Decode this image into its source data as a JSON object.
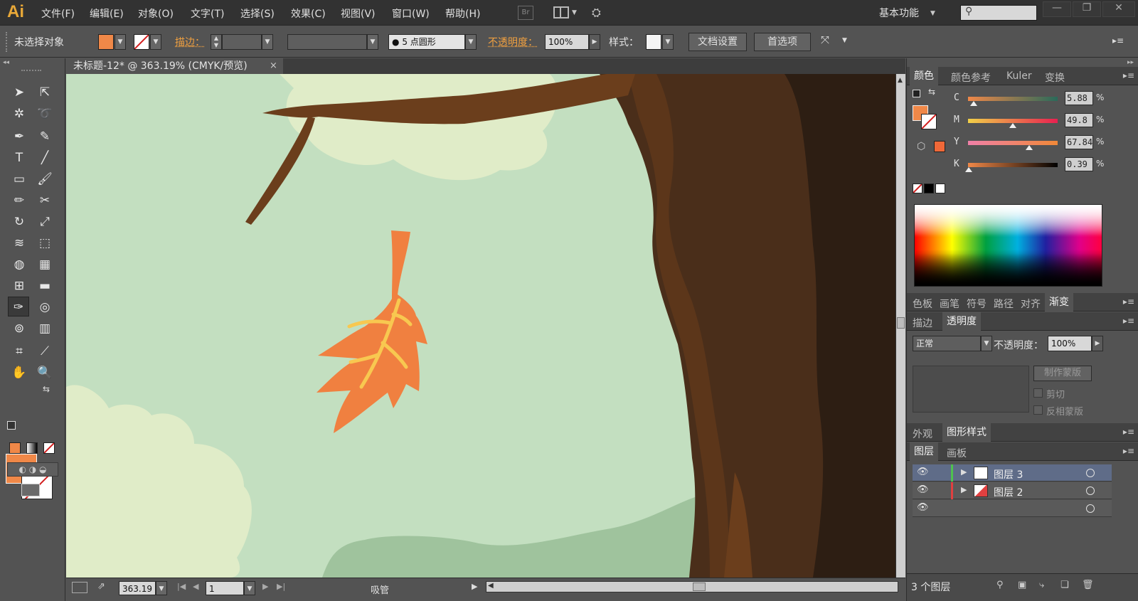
{
  "app": {
    "logo": "Ai",
    "workspace": "基本功能"
  },
  "menu": [
    "文件(F)",
    "编辑(E)",
    "对象(O)",
    "文字(T)",
    "选择(S)",
    "效果(C)",
    "视图(V)",
    "窗口(W)",
    "帮助(H)"
  ],
  "menubar": {
    "bridge": "Br"
  },
  "control": {
    "selection_status": "未选择对象",
    "stroke_label": "描边：",
    "brush_label": "5 点圆形",
    "opacity_label": "不透明度：",
    "opacity_value": "100%",
    "style_label": "样式：",
    "doc_setup": "文档设置",
    "preferences": "首选项"
  },
  "document": {
    "tab_title": "未标题-12* @ 363.19% (CMYK/预览)",
    "close": "×"
  },
  "status": {
    "zoom": "363.19",
    "artboard": "1",
    "current_tool": "吸管"
  },
  "color_panel": {
    "tabs": [
      "颜色",
      "颜色参考",
      "Kuler",
      "变换"
    ],
    "sliders": [
      {
        "letter": "C",
        "value": "5.88",
        "fraction": 0.06
      },
      {
        "letter": "M",
        "value": "49.8",
        "fraction": 0.5
      },
      {
        "letter": "Y",
        "value": "67.84",
        "fraction": 0.68
      },
      {
        "letter": "K",
        "value": "0.39",
        "fraction": 0.004
      }
    ],
    "pct": "%"
  },
  "group2_tabs": [
    "色板",
    "画笔",
    "符号",
    "路径",
    "对齐",
    "渐变"
  ],
  "transparency": {
    "tabs": [
      "描边",
      "透明度"
    ],
    "mode": "正常",
    "opacity_label": "不透明度：",
    "opacity_value": "100%",
    "make_mask": "制作蒙版",
    "clip": "剪切",
    "invert": "反相蒙版"
  },
  "group4_tabs": [
    "外观",
    "图形样式"
  ],
  "layers_panel": {
    "tabs": [
      "图层",
      "画板"
    ],
    "layers": [
      {
        "name": "图层 3",
        "color": "#4fc24f"
      },
      {
        "name": "图层 2",
        "color": "#e04040"
      }
    ],
    "count_label": "3 个图层"
  },
  "colors": {
    "fill": "#f08848",
    "sky": "#c3dfc0",
    "cloud": "#e0ecc8",
    "bark_dark": "#4a2e1a",
    "bark_mid": "#6b3e1c",
    "bark_shadow": "#2d1e13",
    "hill": "#9fc39d",
    "leaf": "#f08040",
    "vein": "#f8c850"
  }
}
